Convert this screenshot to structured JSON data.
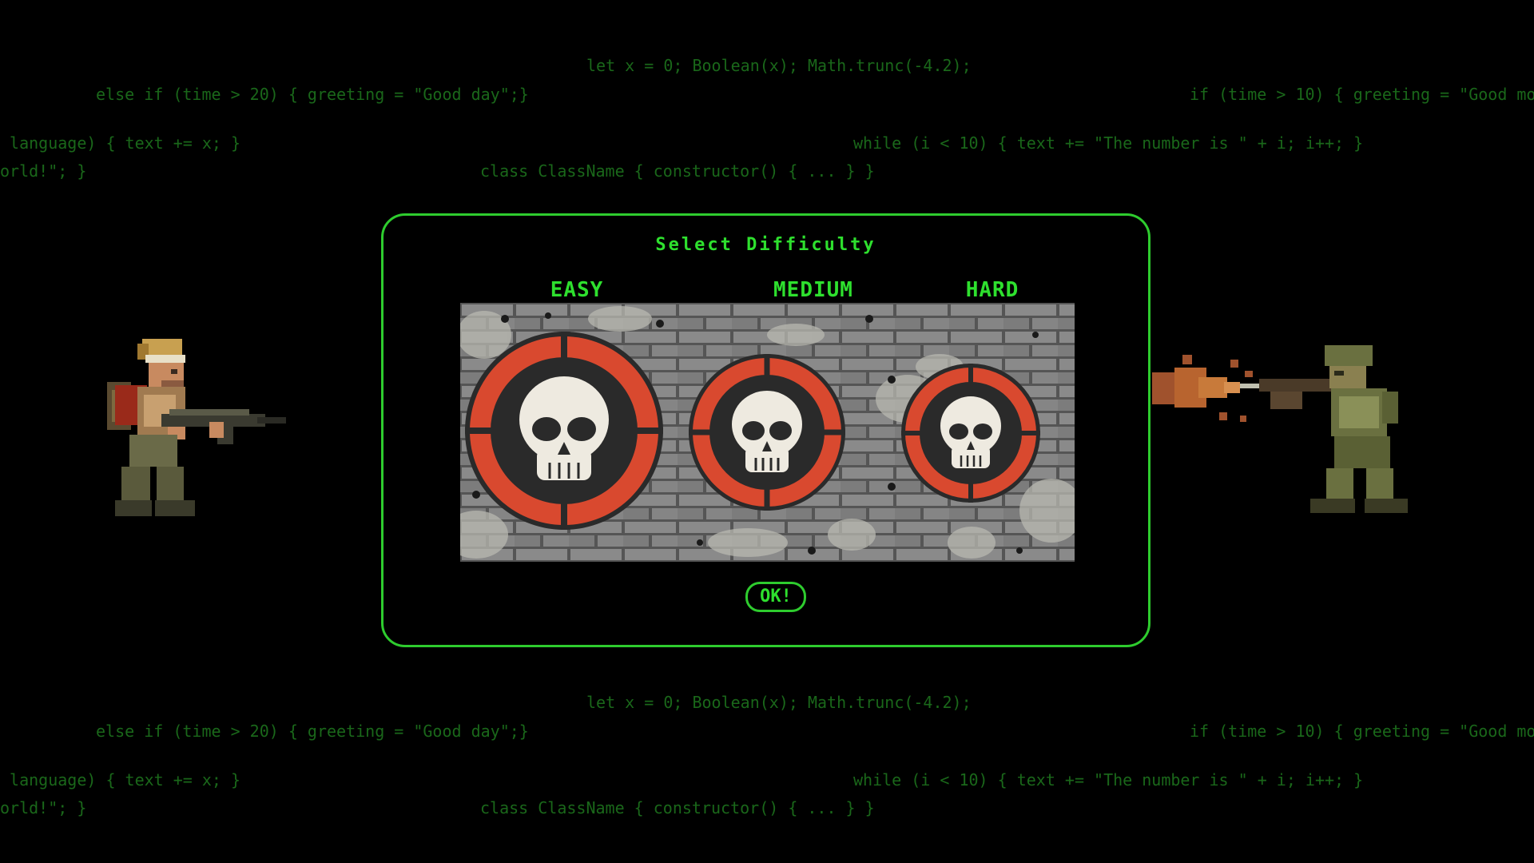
{
  "background_code": {
    "lines": [
      "let x = 0; Boolean(x); Math.trunc(-4.2);",
      "else if (time > 20) { greeting = \"Good day\";}",
      "if (time > 10) { greeting = \"Good mo",
      " language) { text += x; }",
      "while (i < 10) { text += \"The number is \" + i; i++; }",
      "orld!\"; }",
      "class ClassName { constructor() { ... } }",
      "let x = 0; Boolean(x); Math.trunc(-4.2);",
      "else if (time > 20) { greeting = \"Good day\";}",
      "if (time > 10) { greeting = \"Good mo",
      " language) { text += x; }",
      "while (i < 10) { text += \"The number is \" + i; i++; }",
      "orld!\"; }",
      "class ClassName { constructor() { ... } }"
    ]
  },
  "modal": {
    "title": "Select Difficulty",
    "ok_label": "OK!"
  },
  "difficulties": [
    {
      "label": "EASY",
      "icon": "skull-target-icon"
    },
    {
      "label": "MEDIUM",
      "icon": "skull-target-icon"
    },
    {
      "label": "HARD",
      "icon": "skull-target-icon"
    }
  ],
  "colors": {
    "accent_green": "#2ee02e",
    "code_green": "#1f7a1f",
    "target_red": "#d9492f",
    "target_dark": "#2a2a2a",
    "skull_white": "#eeeae0",
    "wall_gray": "#6a6a6a"
  }
}
